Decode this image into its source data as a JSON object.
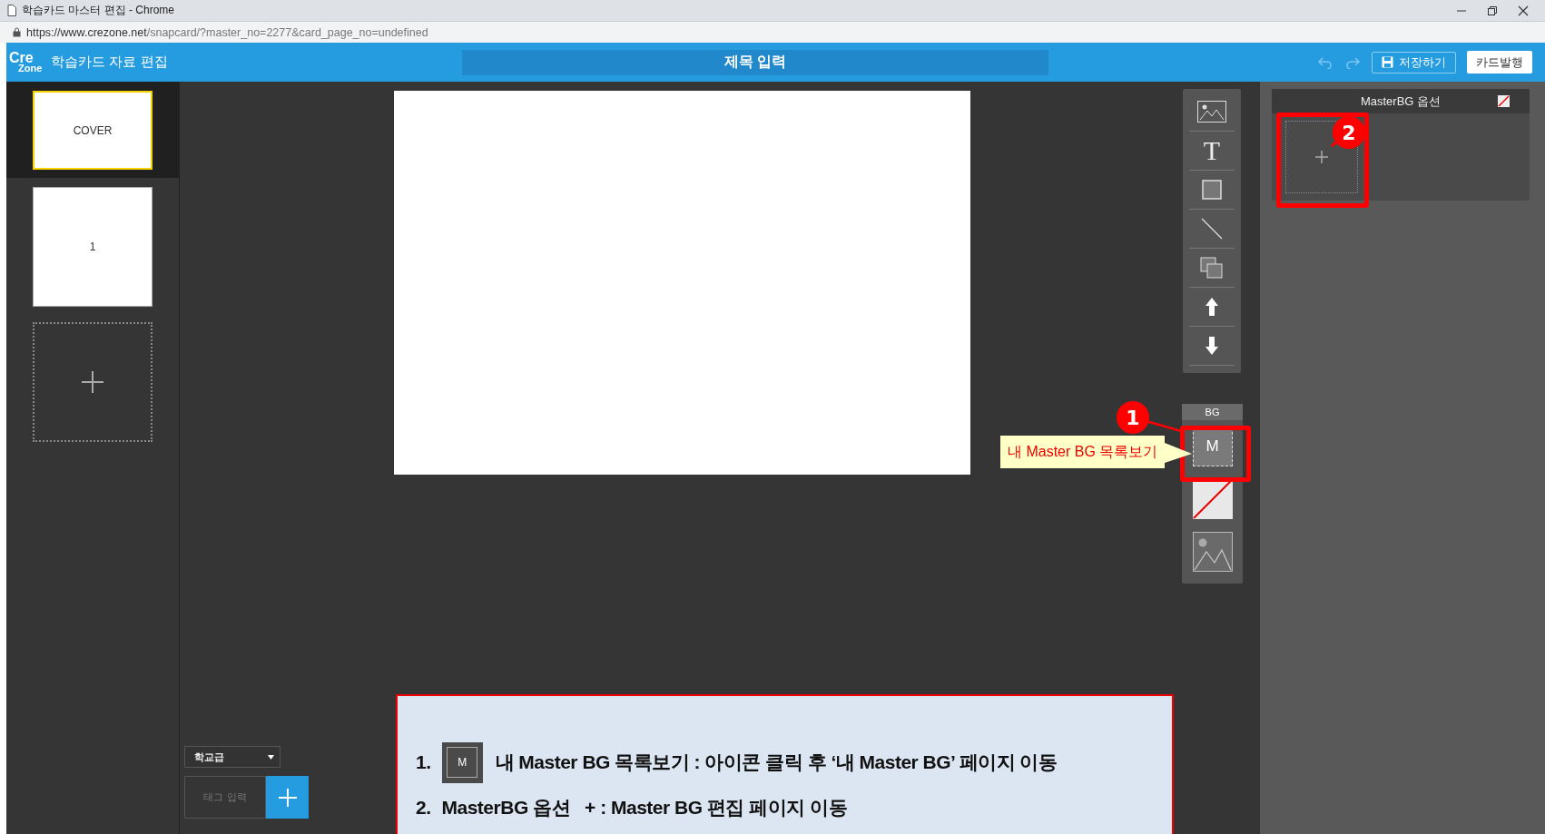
{
  "browser": {
    "tab_title": "학습카드 마스터 편집 - Chrome",
    "url_host": "https://www.crezone.net",
    "url_path": "/snapcard/?master_no=2277&card_page_no=undefined"
  },
  "header": {
    "logo_top": "Cre",
    "logo_bottom": "Zone",
    "app_title": "학습카드 자료 편집",
    "title_field": {
      "placeholder": "제목 입력"
    },
    "save_button": "저장하기",
    "publish_button": "카드발행"
  },
  "pages": [
    {
      "kind": "cover",
      "label": "COVER",
      "selected": true
    },
    {
      "kind": "page",
      "label": "1",
      "selected": false
    }
  ],
  "tag_panel": {
    "level_select": "학교급",
    "tag_field": {
      "placeholder": "태그 입력"
    }
  },
  "tools": [
    {
      "kind": "image"
    },
    {
      "kind": "text",
      "glyph": "T"
    },
    {
      "kind": "rect"
    },
    {
      "kind": "line"
    },
    {
      "kind": "copy"
    },
    {
      "kind": "up"
    },
    {
      "kind": "down"
    }
  ],
  "bg_panel": {
    "label": "BG",
    "items": [
      {
        "kind": "master",
        "label": "M"
      },
      {
        "kind": "none"
      },
      {
        "kind": "image"
      }
    ]
  },
  "master_bg_options": {
    "title": "MasterBG 옵션"
  },
  "annotations": [
    {
      "number": "1",
      "tooltip": "내 Master BG 목록보기"
    },
    {
      "number": "2"
    }
  ],
  "instructions": [
    {
      "number": "1.",
      "icon_label": "M",
      "text": "내 Master BG 목록보기 : 아이콘 클릭 후 ‘내 Master BG’ 페이지 이동"
    },
    {
      "number": "2.",
      "text": "MasterBG 옵션   + : Master BG 편집 페이지 이동"
    }
  ]
}
